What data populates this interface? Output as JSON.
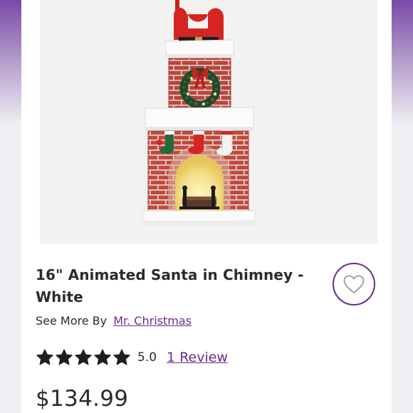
{
  "product": {
    "title": "16\" Animated Santa in Chimney - White",
    "see_more_label": "See More By",
    "brand": "Mr. Christmas",
    "rating": {
      "stars": 5,
      "max_stars": 5,
      "value": "5.0",
      "review_link": "1 Review"
    },
    "price": "$134.99"
  },
  "wishlist": {
    "icon": "heart-outline-icon"
  },
  "colors": {
    "accent": "#6b2a8e",
    "text": "#2b2b2b",
    "edge_gradient_top": "#7a4aa6",
    "image_background": "#f2f2f3"
  }
}
